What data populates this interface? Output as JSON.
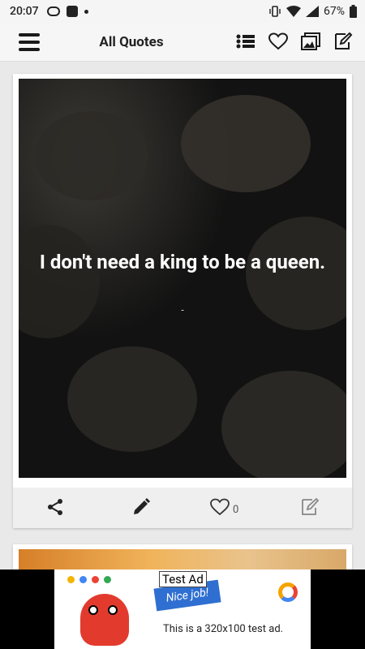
{
  "status_bar": {
    "time": "20:07",
    "battery": "67%"
  },
  "app_bar": {
    "title": "All Quotes"
  },
  "quote_card": {
    "text": "I don't need a king to be a queen.",
    "author": "-",
    "like_count": "0"
  },
  "ad": {
    "tag": "Test Ad",
    "banner_text": "This is a 320x100 test ad.",
    "nice_label": "Nice job!"
  }
}
